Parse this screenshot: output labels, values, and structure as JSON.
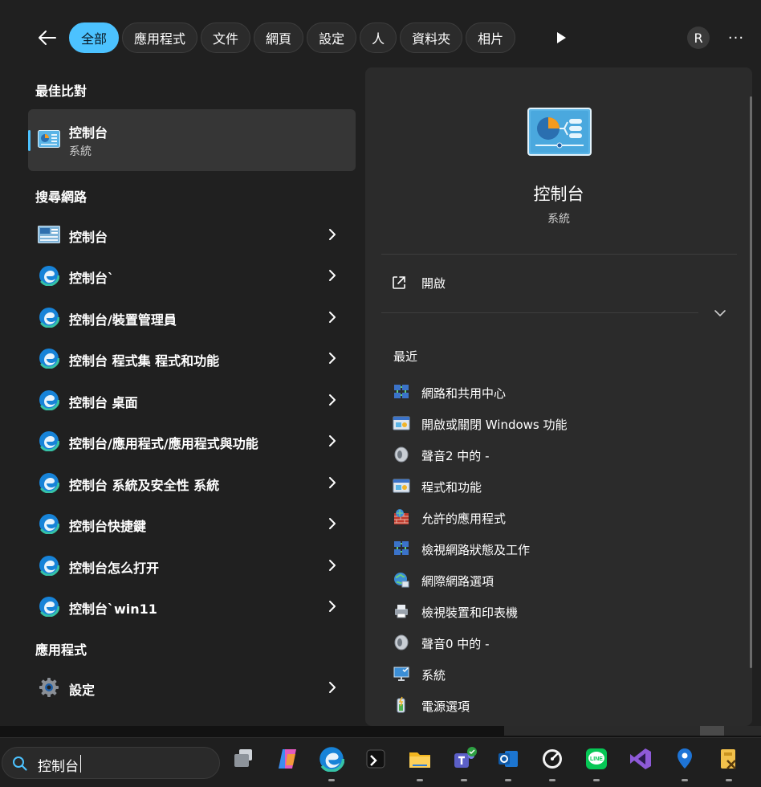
{
  "filters": {
    "back_label": "←",
    "tabs": [
      {
        "label": "全部",
        "active": true
      },
      {
        "label": "應用程式"
      },
      {
        "label": "文件"
      },
      {
        "label": "網頁"
      },
      {
        "label": "設定"
      },
      {
        "label": "人"
      },
      {
        "label": "資料夾"
      },
      {
        "label": "相片"
      }
    ],
    "avatar_initial": "R",
    "more_label": "···"
  },
  "left": {
    "best_match_title": "最佳比對",
    "best_match": {
      "name": "控制台",
      "subtitle": "系統",
      "icon": "control-panel-icon"
    },
    "web_title": "搜尋網路",
    "web_results": [
      {
        "label": "控制台",
        "icon": "control-panel-small-icon"
      },
      {
        "label": "控制台`",
        "icon": "edge-icon"
      },
      {
        "label": "控制台/裝置管理員",
        "icon": "edge-icon"
      },
      {
        "label": "控制台 程式集 程式和功能",
        "icon": "edge-icon"
      },
      {
        "label": "控制台 桌面",
        "icon": "edge-icon"
      },
      {
        "label": "控制台/應用程式/應用程式與功能",
        "icon": "edge-icon"
      },
      {
        "label": "控制台 系統及安全性 系統",
        "icon": "edge-icon"
      },
      {
        "label": "控制台快捷鍵",
        "icon": "edge-icon"
      },
      {
        "label": "控制台怎么打开",
        "icon": "edge-icon"
      },
      {
        "label": "控制台`win11",
        "icon": "edge-icon"
      }
    ],
    "apps_title": "應用程式",
    "apps": [
      {
        "label": "設定",
        "icon": "settings-gear-icon"
      }
    ]
  },
  "preview": {
    "title": "控制台",
    "subtitle": "系統",
    "open_label": "開啟",
    "recent_title": "最近",
    "recent": [
      {
        "label": "網路和共用中心",
        "icon": "network-icon"
      },
      {
        "label": "開啟或關閉 Windows 功能",
        "icon": "programs-icon"
      },
      {
        "label": "聲音2 中的 -",
        "icon": "sound-icon"
      },
      {
        "label": "程式和功能",
        "icon": "programs-icon"
      },
      {
        "label": "允許的應用程式",
        "icon": "firewall-icon"
      },
      {
        "label": "檢視網路狀態及工作",
        "icon": "network-icon"
      },
      {
        "label": "網際網路選項",
        "icon": "internet-options-icon"
      },
      {
        "label": "檢視裝置和印表機",
        "icon": "printer-icon"
      },
      {
        "label": "聲音0 中的 -",
        "icon": "sound-icon"
      },
      {
        "label": "系統",
        "icon": "system-icon"
      },
      {
        "label": "電源選項",
        "icon": "power-icon"
      }
    ]
  },
  "taskbar": {
    "search_value": "控制台",
    "apps": [
      "task-view-icon",
      "copilot-icon",
      "edge-icon",
      "terminal-icon",
      "file-explorer-icon",
      "teams-icon",
      "outlook-icon",
      "speedometer-icon",
      "line-icon",
      "visual-studio-icon",
      "maps-pin-icon",
      "tools-icon"
    ]
  },
  "colors": {
    "accent": "#4cc2ff",
    "panel_bg": "#202020",
    "preview_bg": "#2b2b2b"
  }
}
